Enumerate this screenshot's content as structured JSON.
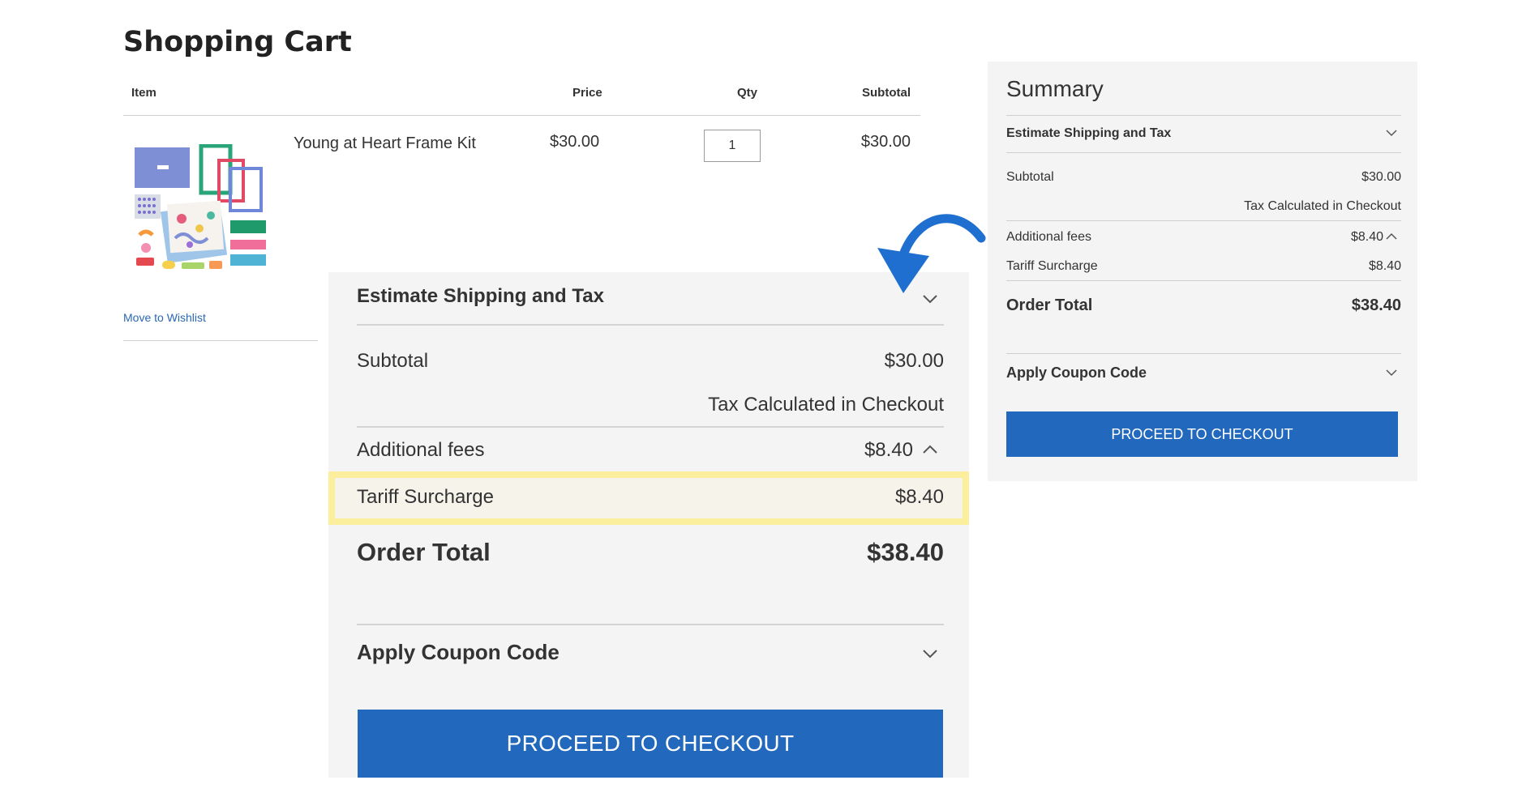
{
  "page": {
    "title": "Shopping Cart"
  },
  "table": {
    "col_item": "Item",
    "col_price": "Price",
    "col_qty": "Qty",
    "col_subtotal": "Subtotal"
  },
  "product": {
    "name": "Young at Heart Frame Kit",
    "price": "$30.00",
    "qty": "1",
    "subtotal": "$30.00",
    "wishlist": "Move to Wishlist"
  },
  "summary": {
    "title": "Summary",
    "estimate_label": "Estimate Shipping and Tax",
    "subtotal_label": "Subtotal",
    "subtotal_value": "$30.00",
    "tax_note": "Tax Calculated in Checkout",
    "fees_label": "Additional fees",
    "fees_value": "$8.40",
    "tariff_label": "Tariff Surcharge",
    "tariff_value": "$8.40",
    "total_label": "Order Total",
    "total_value": "$38.40",
    "coupon_label": "Apply Coupon Code",
    "checkout_label": "PROCEED TO CHECKOUT"
  },
  "colors": {
    "accent": "#2269bd",
    "link": "#2a68b6",
    "highlight": "#fbee9c",
    "arrow": "#1f6fd0",
    "panel_bg": "#f4f4f4"
  },
  "icons": {
    "chevron_down": "chevron-down-icon",
    "chevron_up": "chevron-up-icon",
    "arrow": "curved-arrow-icon"
  }
}
